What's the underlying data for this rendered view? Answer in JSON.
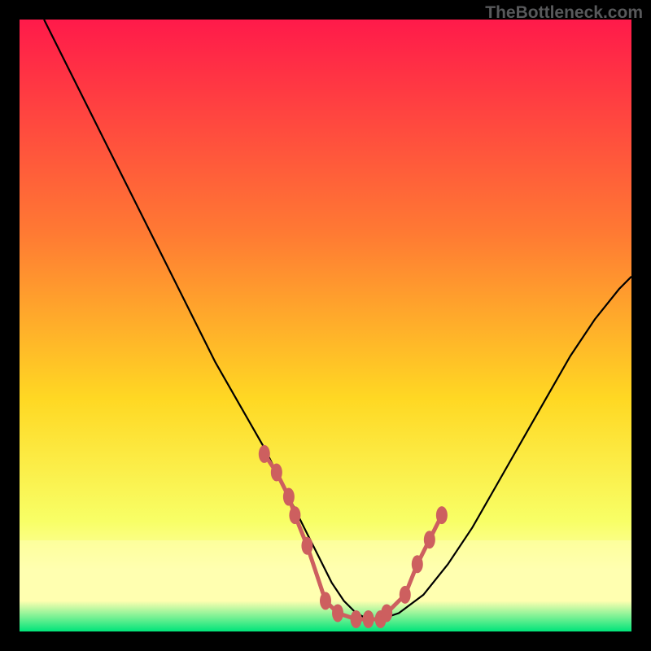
{
  "watermark": "TheBottleneck.com",
  "colors": {
    "bg": "#000000",
    "curve": "#000000",
    "marker_fill": "#cd5f5f",
    "marker_strand": "#cd5f5f",
    "grad_top": "#ff1a4a",
    "grad_mid_top": "#ff7a33",
    "grad_mid": "#ffd823",
    "grad_low": "#f8ff66",
    "grad_band": "#ffffb0",
    "grad_bottom": "#00e47a"
  },
  "chart_data": {
    "type": "line",
    "title": "",
    "xlabel": "",
    "ylabel": "",
    "xlim": [
      0,
      100
    ],
    "ylim": [
      0,
      100
    ],
    "series": [
      {
        "name": "bottleneck-curve",
        "x": [
          4,
          8,
          12,
          16,
          20,
          24,
          28,
          32,
          36,
          40,
          43,
          45,
          47,
          49,
          51,
          53,
          55,
          57,
          59,
          62,
          66,
          70,
          74,
          78,
          82,
          86,
          90,
          94,
          98,
          100
        ],
        "values": [
          100,
          92,
          84,
          76,
          68,
          60,
          52,
          44,
          37,
          30,
          24,
          20,
          16,
          12,
          8,
          5,
          3,
          2,
          2,
          3,
          6,
          11,
          17,
          24,
          31,
          38,
          45,
          51,
          56,
          58
        ]
      }
    ],
    "markers": {
      "name": "highlighted-points",
      "x": [
        40,
        42,
        44,
        45,
        47,
        50,
        52,
        55,
        57,
        59,
        60,
        63,
        65,
        67,
        69
      ],
      "values": [
        29,
        26,
        22,
        19,
        14,
        5,
        3,
        2,
        2,
        2,
        3,
        6,
        11,
        15,
        19
      ]
    }
  }
}
